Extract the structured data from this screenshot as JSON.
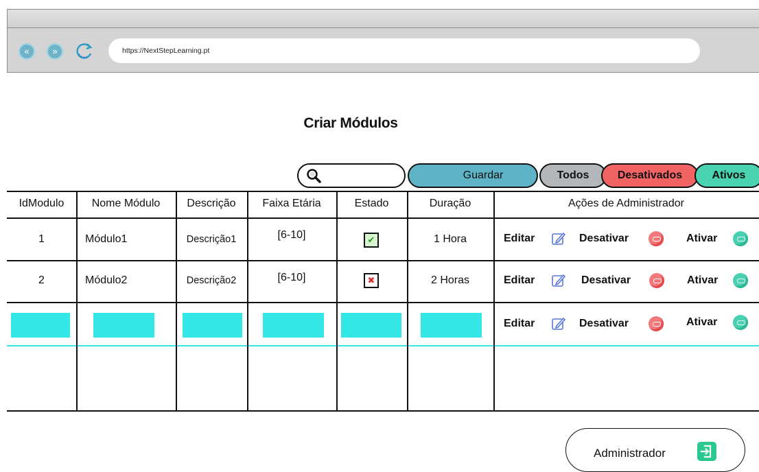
{
  "browser": {
    "url": "https://NextStepLearning.pt",
    "back_icon": "back-arrow-icon",
    "forward_icon": "forward-arrow-icon",
    "reload_icon": "reload-icon"
  },
  "page": {
    "title": "Criar Módulos"
  },
  "toolbar": {
    "search_value": "",
    "save_label": "Guardar",
    "filters": {
      "all": "Todos",
      "disabled": "Desativados",
      "active": "Ativos"
    }
  },
  "table": {
    "headers": [
      "IdModulo",
      "Nome Módulo",
      "Descrição",
      "Faixa Etária",
      "Estado",
      "Duração",
      "Ações de Administrador"
    ],
    "rows": [
      {
        "id": "1",
        "name": "Módulo1",
        "description": "Descrição1",
        "age_range": "[6-10]",
        "state": "active",
        "duration": "1 Hora"
      },
      {
        "id": "2",
        "name": "Módulo2",
        "description": "Descrição2",
        "age_range": "[6-10]",
        "state": "inactive",
        "duration": "2 Horas"
      }
    ],
    "actions": {
      "edit": "Editar",
      "disable": "Desativar",
      "enable": "Ativar"
    }
  },
  "footer": {
    "admin_label": "Administrador"
  },
  "colors": {
    "save": "#5fb3c7",
    "all": "#b4b7b9",
    "disabled": "#f26464",
    "active": "#49d3b0",
    "placeholder": "#35e6e6"
  }
}
